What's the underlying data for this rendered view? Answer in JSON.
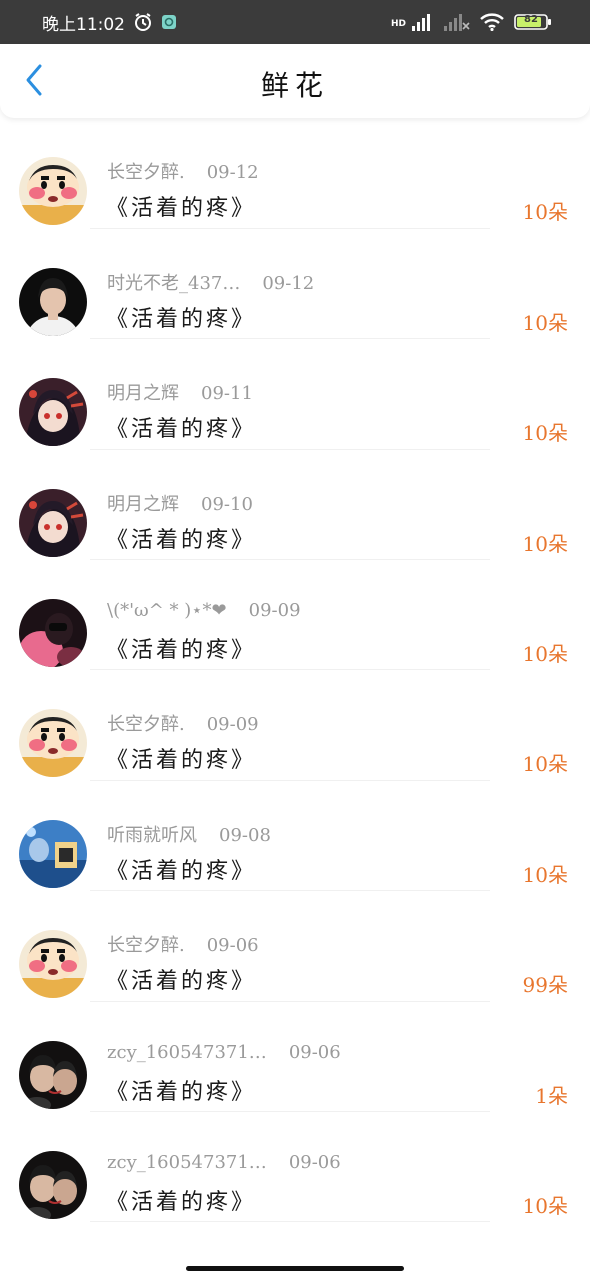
{
  "status_bar": {
    "time": "晚上11:02",
    "hd_label": "HD",
    "battery": "82",
    "icons": [
      "alarm-icon",
      "app-notification-icon",
      "signal-icon",
      "no-signal-icon",
      "wifi-icon",
      "battery-icon"
    ]
  },
  "header": {
    "title": "鲜花",
    "back_icon": "chevron-left-icon"
  },
  "colors": {
    "accent": "#e8762e",
    "back": "#2b8fe0",
    "statusbar": "#3b3b3b"
  },
  "gifts": [
    {
      "user": "",
      "date": "",
      "book": "《活着的疼》",
      "amount": "10朵",
      "avatar": "blue-sky"
    },
    {
      "user": "长空夕醉.",
      "date": "09-12",
      "book": "《活着的疼》",
      "amount": "10朵",
      "avatar": "cartoon"
    },
    {
      "user": "时光不老_437…",
      "date": "09-12",
      "book": "《活着的疼》",
      "amount": "10朵",
      "avatar": "dark-portrait"
    },
    {
      "user": "明月之辉",
      "date": "09-11",
      "book": "《活着的疼》",
      "amount": "10朵",
      "avatar": "anime-red"
    },
    {
      "user": "明月之辉",
      "date": "09-10",
      "book": "《活着的疼》",
      "amount": "10朵",
      "avatar": "anime-red"
    },
    {
      "user": "\\(*'ω^ * )⋆*❤",
      "date": "09-09",
      "book": "《活着的疼》",
      "amount": "10朵",
      "avatar": "pink-dark"
    },
    {
      "user": "长空夕醉.",
      "date": "09-09",
      "book": "《活着的疼》",
      "amount": "10朵",
      "avatar": "cartoon"
    },
    {
      "user": "听雨就听风",
      "date": "09-08",
      "book": "《活着的疼》",
      "amount": "10朵",
      "avatar": "blue-art"
    },
    {
      "user": "长空夕醉.",
      "date": "09-06",
      "book": "《活着的疼》",
      "amount": "99朵",
      "avatar": "cartoon"
    },
    {
      "user": "zcy_160547371…",
      "date": "09-06",
      "book": "《活着的疼》",
      "amount": "1朵",
      "avatar": "couple"
    },
    {
      "user": "zcy_160547371…",
      "date": "09-06",
      "book": "《活着的疼》",
      "amount": "10朵",
      "avatar": "couple"
    }
  ]
}
